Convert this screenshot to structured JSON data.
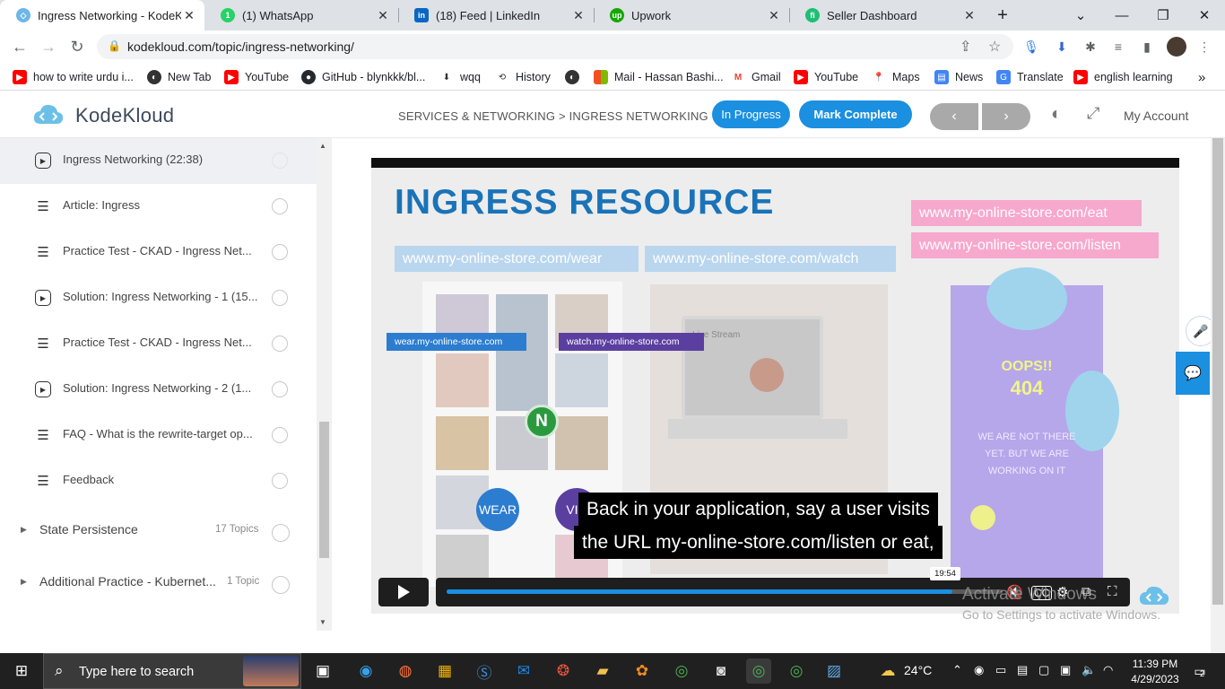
{
  "browser": {
    "tabs": [
      {
        "title": "Ingress Networking - KodeKl",
        "active": true
      },
      {
        "title": "(1) WhatsApp",
        "active": false
      },
      {
        "title": "(18) Feed | LinkedIn",
        "active": false
      },
      {
        "title": "Upwork",
        "active": false
      },
      {
        "title": "Seller Dashboard",
        "active": false
      }
    ],
    "url": "kodekloud.com/topic/ingress-networking/",
    "bookmarks": [
      "how to write urdu i...",
      "New Tab",
      "YouTube",
      "GitHub - blynkkk/bl...",
      "wqq",
      "History",
      "Mail - Hassan Bashi...",
      "Gmail",
      "YouTube",
      "Maps",
      "News",
      "Translate",
      "english learning"
    ]
  },
  "site": {
    "logo_text": "KodeKloud",
    "breadcrumb": "SERVICES & NETWORKING > INGRESS NETWORKING",
    "status_label": "In Progress",
    "mark_complete_label": "Mark Complete",
    "prev_label": "‹",
    "next_label": "›",
    "account_label": "My Account"
  },
  "sidebar": {
    "lessons": [
      {
        "label": "Ingress Networking (22:38)",
        "type": "video",
        "current": true
      },
      {
        "label": "Article: Ingress",
        "type": "doc"
      },
      {
        "label": "Practice Test - CKAD - Ingress Net...",
        "type": "doc"
      },
      {
        "label": "Solution: Ingress Networking - 1 (15...",
        "type": "video"
      },
      {
        "label": "Practice Test - CKAD - Ingress Net...",
        "type": "doc"
      },
      {
        "label": "Solution: Ingress Networking - 2 (1...",
        "type": "video"
      },
      {
        "label": "FAQ - What is the rewrite-target op...",
        "type": "doc"
      },
      {
        "label": "Feedback",
        "type": "doc"
      }
    ],
    "sections": [
      {
        "label": "State Persistence",
        "count": "17 Topics"
      },
      {
        "label": "Additional Practice - Kubernet...",
        "count": "1 Topic"
      }
    ]
  },
  "video": {
    "slide_title": "INGRESS RESOURCE",
    "urls": {
      "wear": "www.my-online-store.com/wear",
      "watch": "www.my-online-store.com/watch",
      "eat": "www.my-online-store.com/eat",
      "listen": "www.my-online-store.com/listen"
    },
    "tags": {
      "wear": "wear.my-online-store.com",
      "watch": "watch.my-online-store.com"
    },
    "live_stream": "Live Stream",
    "wear_badge": "WEAR",
    "vid_badge": "VID",
    "nginx_badge": "N",
    "oops": "OOPS!!",
    "code404": "404",
    "not_there": "WE ARE NOT THERE YET. BUT WE ARE WORKING ON IT",
    "subtitles": [
      "Back in your application, say a user visits",
      "the URL my-online-store.com/listen or eat,"
    ],
    "timestamp": "19:54",
    "progress_fraction": 0.91
  },
  "os": {
    "watermark_title": "Activate Windows",
    "watermark_sub": "Go to Settings to activate Windows.",
    "search_placeholder": "Type here to search",
    "weather": "24°C",
    "time": "11:39 PM",
    "date": "4/29/2023",
    "notifications": "2"
  }
}
